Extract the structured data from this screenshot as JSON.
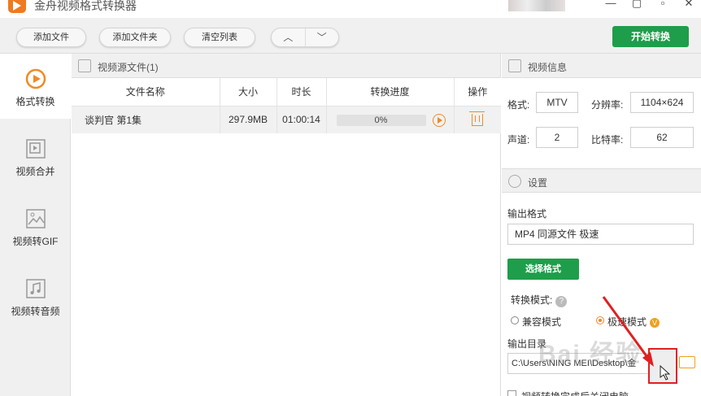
{
  "window": {
    "title": "金舟视频格式转换器",
    "controls": [
      "—",
      "▢",
      "▫",
      "✕"
    ]
  },
  "toolbar": {
    "add_file": "添加文件",
    "add_folder": "添加文件夹",
    "clear_list": "清空列表",
    "up": "︿",
    "down": "﹀",
    "start": "开始转换"
  },
  "sidebar": {
    "items": [
      {
        "label": "格式转换",
        "active": true
      },
      {
        "label": "视频合并",
        "active": false
      },
      {
        "label": "视频转GIF",
        "active": false
      },
      {
        "label": "视频转音频",
        "active": false
      }
    ]
  },
  "source": {
    "title": "视频源文件(1)",
    "columns": [
      "文件名称",
      "大小",
      "时长",
      "转换进度",
      "操作"
    ],
    "rows": [
      {
        "name": "谈判官 第1集",
        "size": "297.9MB",
        "duration": "01:00:14",
        "progress": "0%",
        "progress_value": 0
      }
    ]
  },
  "info": {
    "title": "视频信息",
    "format_label": "格式:",
    "format_value": "MTV",
    "resolution_label": "分辨率:",
    "resolution_value": "1104×624",
    "channel_label": "声道:",
    "channel_value": "2",
    "bitrate_label": "比特率:",
    "bitrate_value": "62"
  },
  "settings": {
    "title": "设置",
    "output_format_label": "输出格式",
    "output_format_value": "MP4 同源文件 极速",
    "select_format_button": "选择格式",
    "mode_label": "转换模式:",
    "mode_help": "?",
    "mode_compat": "兼容模式",
    "mode_fast": "极速模式",
    "mode_fast_badge": "V",
    "output_dir_label": "输出目录",
    "output_dir_value": "C:\\Users\\NING MEI\\Desktop\\金",
    "close_after_label": "视频转换完成后关闭电脑"
  },
  "watermark": "Bai 经验",
  "colors": {
    "accent_green": "#1e9e4a",
    "accent_orange": "#f08a26",
    "annotation_red": "#e02020"
  }
}
